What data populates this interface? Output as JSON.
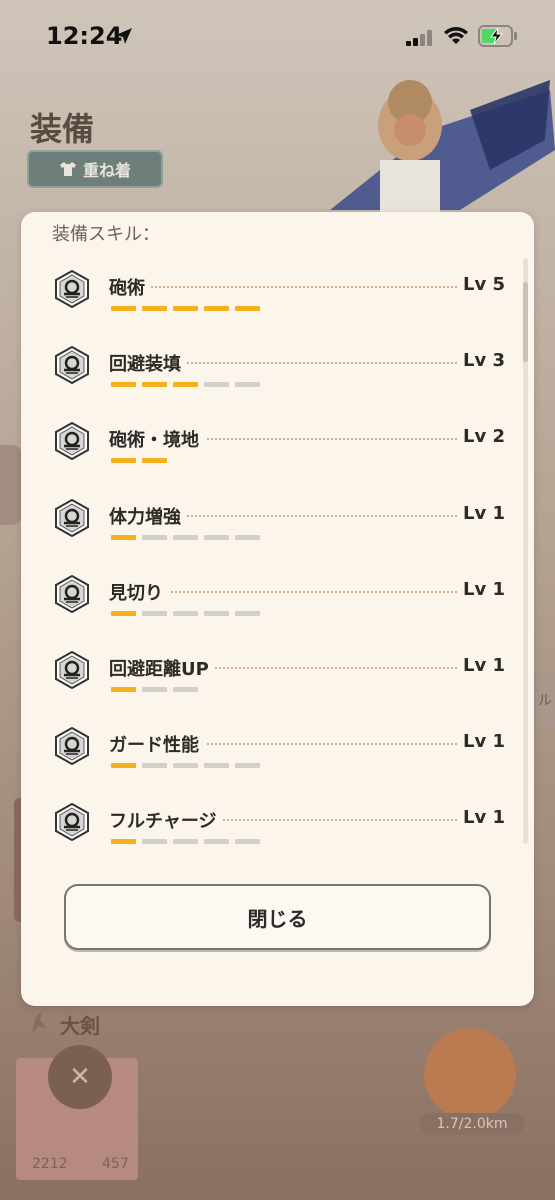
{
  "status": {
    "time": "12:24"
  },
  "background": {
    "title": "装備",
    "layer_button": "重ね着",
    "weapon_label": "大剣",
    "card_num1": "2212",
    "card_num2": "457",
    "distance": "1.7/2.0km",
    "edge_text": "ル"
  },
  "modal": {
    "header": "装備スキル：",
    "skills": [
      {
        "name": "砲術",
        "level": "Lv 5",
        "filled": 5,
        "total": 5
      },
      {
        "name": "回避装填",
        "level": "Lv 3",
        "filled": 3,
        "total": 5
      },
      {
        "name": "砲術・境地",
        "level": "Lv 2",
        "filled": 2,
        "total": 2
      },
      {
        "name": "体力増強",
        "level": "Lv 1",
        "filled": 1,
        "total": 5
      },
      {
        "name": "見切り",
        "level": "Lv 1",
        "filled": 1,
        "total": 5
      },
      {
        "name": "回避距離UP",
        "level": "Lv 1",
        "filled": 1,
        "total": 3
      },
      {
        "name": "ガード性能",
        "level": "Lv 1",
        "filled": 1,
        "total": 5
      },
      {
        "name": "フルチャージ",
        "level": "Lv 1",
        "filled": 1,
        "total": 5
      }
    ],
    "close_label": "閉じる"
  },
  "colors": {
    "bar_on": "#f5b11b",
    "bar_off": "#d3d0cb",
    "modal_bg": "#fbf5ec"
  }
}
